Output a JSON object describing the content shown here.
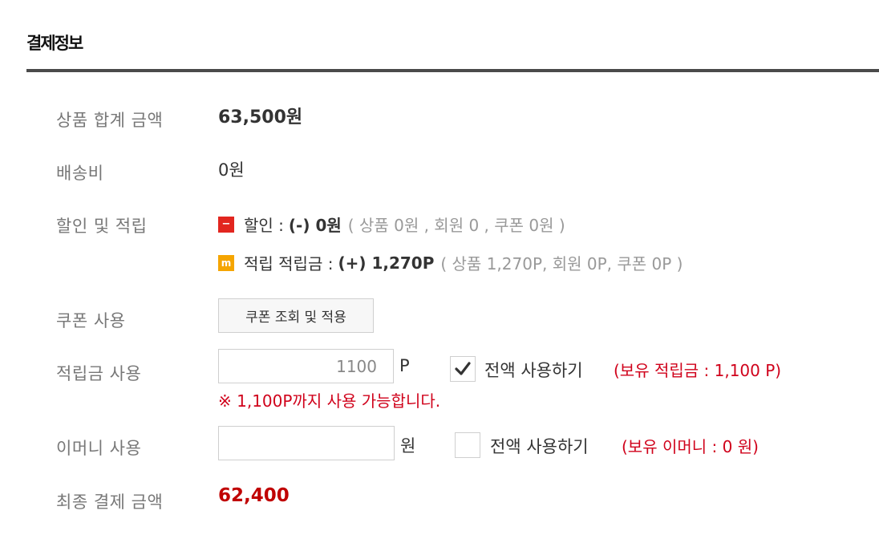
{
  "section": {
    "title": "결제정보"
  },
  "subtotal": {
    "label": "상품 합계 금액",
    "value": "63,500원"
  },
  "shipping": {
    "label": "배송비",
    "value": "0원"
  },
  "discount": {
    "label": "할인 및 적립",
    "discount_badge": "−",
    "discount_label": "할인 :",
    "discount_value": "(-) 0원",
    "discount_detail": "( 상품 0원 , 회원 0 , 쿠폰 0원 )",
    "points_badge": "m",
    "points_label": "적립 적립금 :",
    "points_value": "(+) 1,270P",
    "points_detail": "( 상품 1,270P, 회원 0P, 쿠폰 0P )"
  },
  "coupon": {
    "label": "쿠폰 사용",
    "button": "쿠폰 조회 및 적용"
  },
  "points_use": {
    "label": "적립금 사용",
    "input_value": "1100",
    "unit": "P",
    "checkbox_checked": true,
    "checkbox_label": "전액 사용하기",
    "holdings": "(보유 적립금 : 1,100 P)",
    "notice": "※ 1,100P까지 사용 가능합니다."
  },
  "emoney_use": {
    "label": "이머니 사용",
    "input_value": "",
    "unit": "원",
    "checkbox_checked": false,
    "checkbox_label": "전액 사용하기",
    "holdings": "(보유 이머니 : 0 원)"
  },
  "final_amount": {
    "label": "최종 결제 금액",
    "value": "62,400"
  },
  "icons": {
    "check": "checkmark-icon",
    "discount": "minus-badge-icon",
    "points": "mileage-badge-icon"
  },
  "colors": {
    "accent_red": "#d0021b",
    "final_red": "#c00000",
    "badge_red": "#e2261f",
    "badge_orange": "#f5a500"
  }
}
